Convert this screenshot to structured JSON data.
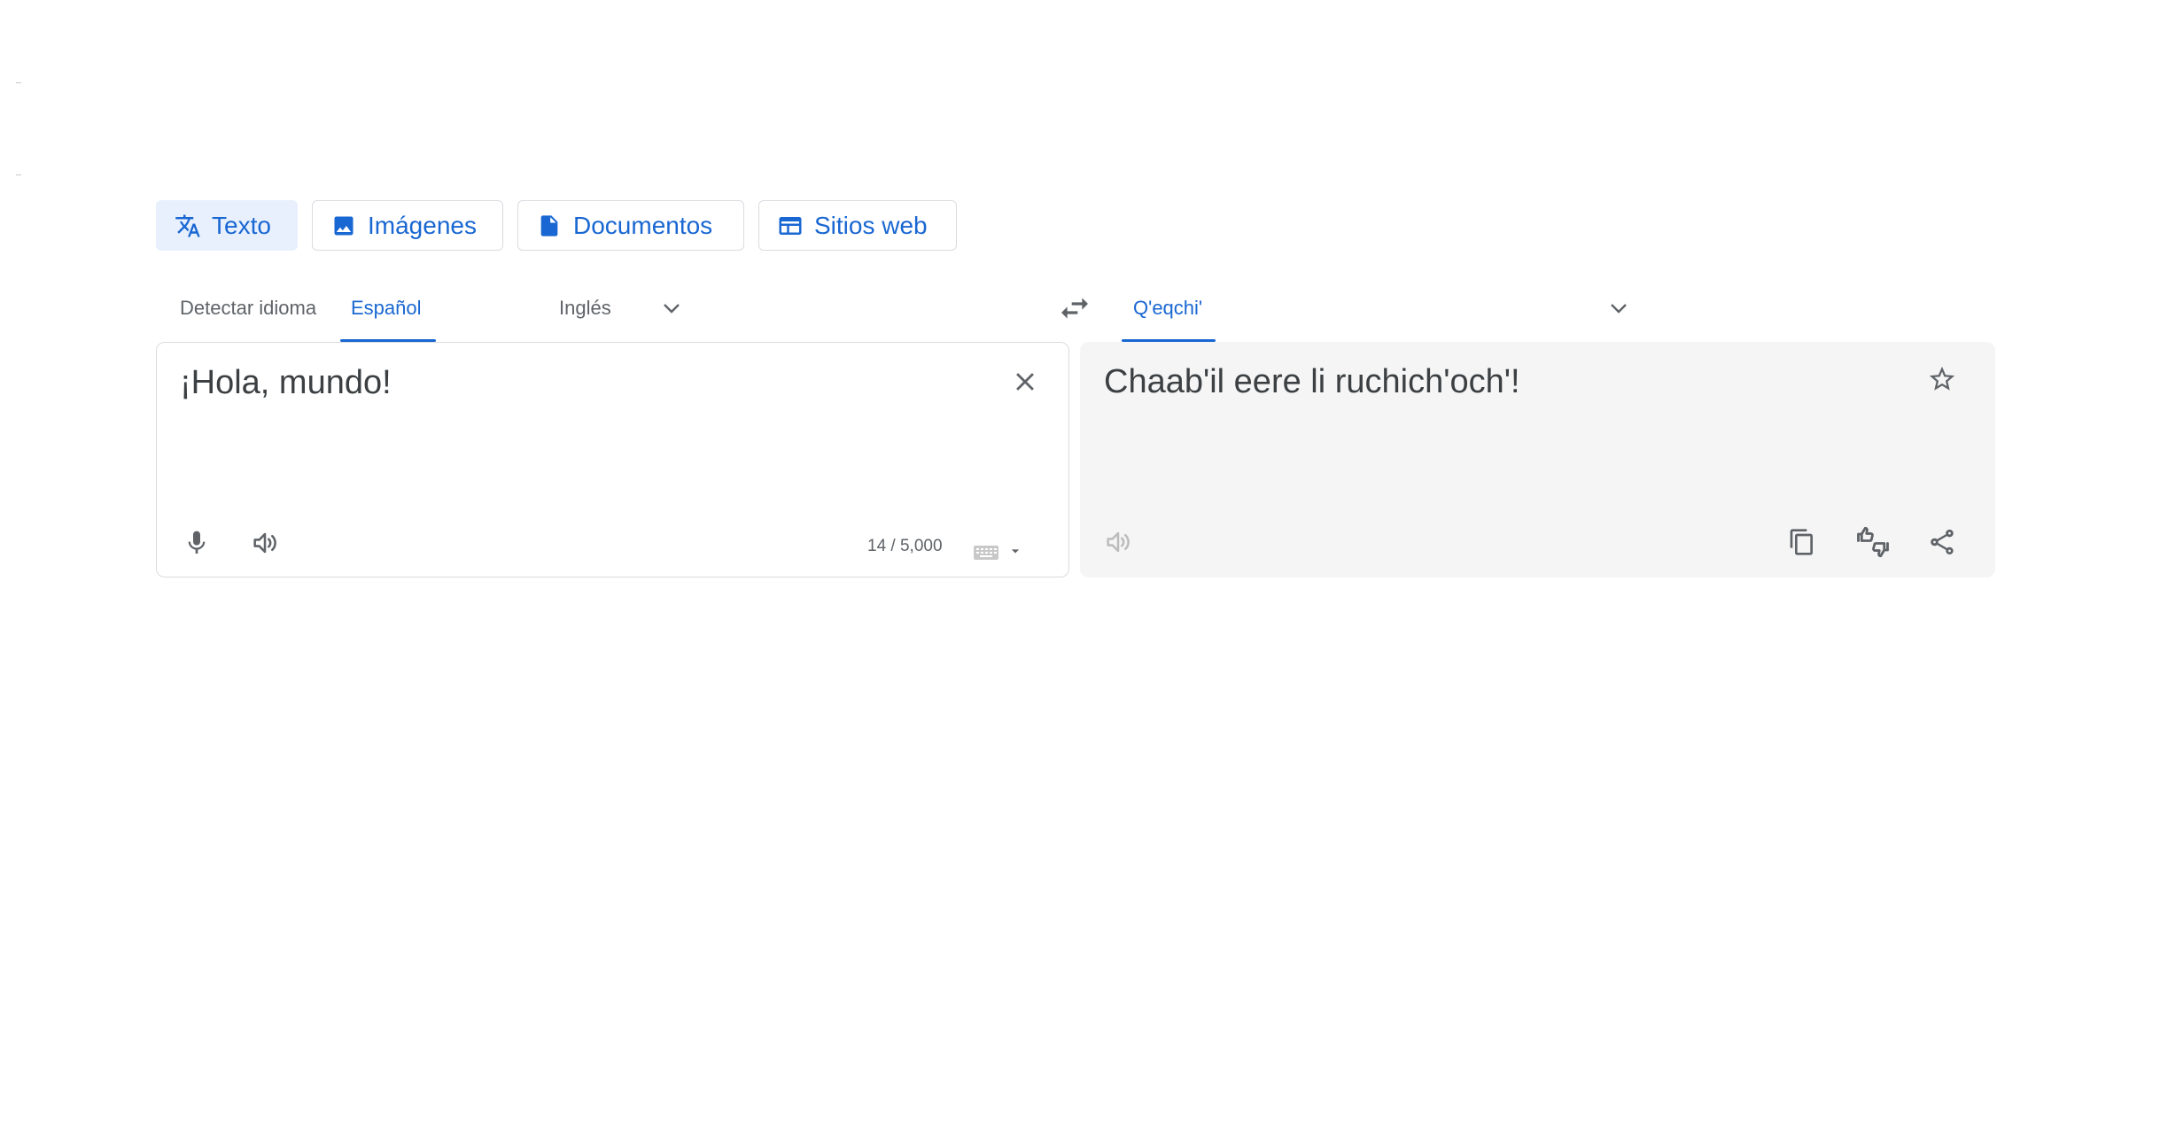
{
  "tabs": [
    {
      "label": "Texto",
      "icon": "translate-icon",
      "active": true
    },
    {
      "label": "Imágenes",
      "icon": "image-icon",
      "active": false
    },
    {
      "label": "Documentos",
      "icon": "document-icon",
      "active": false
    },
    {
      "label": "Sitios web",
      "icon": "website-icon",
      "active": false
    }
  ],
  "source_langs": {
    "detect": "Detectar idioma",
    "selected": "Español",
    "other": "Inglés"
  },
  "target_langs": {
    "selected": "Q'eqchi'"
  },
  "source": {
    "text": "¡Hola, mundo!",
    "counter": "14 / 5,000"
  },
  "target": {
    "text": "Chaab'il eere li ruchich'och'!"
  },
  "colors": {
    "accent": "#1967d2",
    "active_tab_bg": "#e8f0fe",
    "target_panel_bg": "#f5f5f5",
    "text": "#3c4043",
    "muted": "#5f6368"
  }
}
